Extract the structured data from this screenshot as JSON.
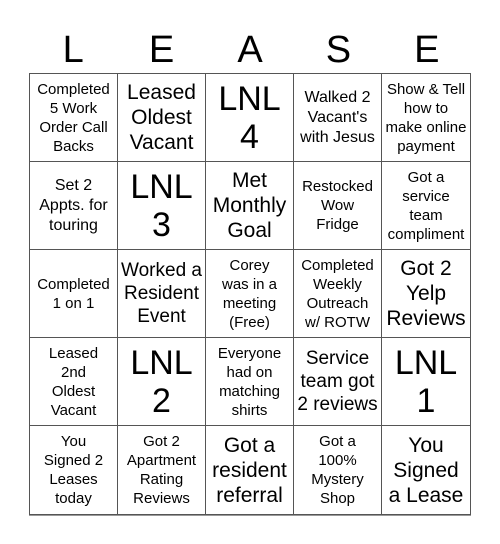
{
  "header": {
    "letters": [
      "L",
      "E",
      "A",
      "S",
      "E"
    ]
  },
  "board": {
    "cells": [
      {
        "text": "Completed\n5 Work\nOrder Call\nBacks",
        "size": "s1"
      },
      {
        "text": "Leased\nOldest\nVacant",
        "size": "s4"
      },
      {
        "text": "LNL\n4",
        "size": "s5"
      },
      {
        "text": "Walked 2\nVacant's\nwith Jesus",
        "size": "s2"
      },
      {
        "text": "Show & Tell\nhow to\nmake online\npayment",
        "size": "s1"
      },
      {
        "text": "Set 2\nAppts. for\ntouring",
        "size": "s2"
      },
      {
        "text": "LNL\n3",
        "size": "s5"
      },
      {
        "text": "Met\nMonthly\nGoal",
        "size": "s4"
      },
      {
        "text": "Restocked\nWow\nFridge",
        "size": "s1"
      },
      {
        "text": "Got a\nservice\nteam\ncompliment",
        "size": "s1"
      },
      {
        "text": "Completed\n1 on 1",
        "size": "s1"
      },
      {
        "text": "Worked a\nResident\nEvent",
        "size": "s3"
      },
      {
        "text": "Corey\nwas in a\nmeeting\n(Free)",
        "size": "s1"
      },
      {
        "text": "Completed\nWeekly\nOutreach\nw/ ROTW",
        "size": "s1"
      },
      {
        "text": "Got 2\nYelp\nReviews",
        "size": "s4"
      },
      {
        "text": "Leased\n2nd\nOldest\nVacant",
        "size": "s1"
      },
      {
        "text": "LNL\n2",
        "size": "s5"
      },
      {
        "text": "Everyone\nhad on\nmatching\nshirts",
        "size": "s1"
      },
      {
        "text": "Service\nteam got\n2 reviews",
        "size": "s3"
      },
      {
        "text": "LNL\n1",
        "size": "s5"
      },
      {
        "text": "You\nSigned 2\nLeases\ntoday",
        "size": "s1"
      },
      {
        "text": "Got 2\nApartment\nRating\nReviews",
        "size": "s1"
      },
      {
        "text": "Got a\nresident\nreferral",
        "size": "s4"
      },
      {
        "text": "Got a\n100%\nMystery\nShop",
        "size": "s1"
      },
      {
        "text": "You\nSigned\na Lease",
        "size": "s4"
      }
    ]
  }
}
